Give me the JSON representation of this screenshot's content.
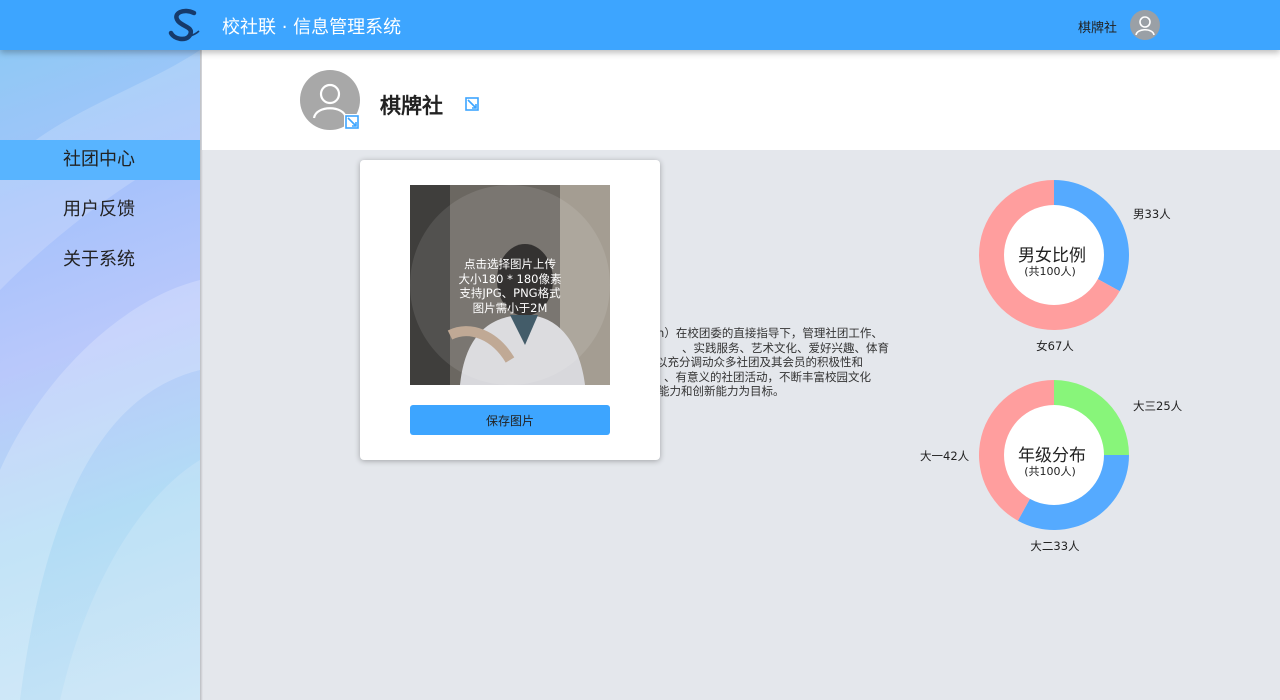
{
  "header": {
    "title": "校社联 · 信息管理系统",
    "username": "棋牌社"
  },
  "sidebar": {
    "items": [
      {
        "label": "社团中心",
        "active": true
      },
      {
        "label": "用户反馈",
        "active": false
      },
      {
        "label": "关于系统",
        "active": false
      }
    ]
  },
  "club": {
    "name": "棋牌社"
  },
  "description": {
    "lines": [
      "on）在校团委的直接指导下，管理社团工作、",
      "、实践服务、艺术文化、爱好兴趣、体育",
      "以充分调动众多社团及其会员的积极性和",
      "、有意义的社团活动，不断丰富校园文化",
      "能力和创新能力为目标。"
    ]
  },
  "upload": {
    "hint_lines": [
      "点击选择图片上传",
      "大小180 * 180像素",
      "支持JPG、PNG格式",
      "图片需小于2M"
    ],
    "save_label": "保存图片"
  },
  "chart_data": [
    {
      "type": "pie",
      "title": "男女比例",
      "subtitle": "(共100人)",
      "slices": [
        {
          "label": "男33人",
          "value": 33,
          "color": "#55aaff"
        },
        {
          "label": "女67人",
          "value": 67,
          "color": "#ff9e9e"
        }
      ]
    },
    {
      "type": "pie",
      "title": "年级分布",
      "subtitle": "(共100人)",
      "slices": [
        {
          "label": "大三25人",
          "value": 25,
          "color": "#88f57a"
        },
        {
          "label": "大二33人",
          "value": 33,
          "color": "#55aaff"
        },
        {
          "label": "大一42人",
          "value": 42,
          "color": "#ff9e9e"
        }
      ]
    }
  ]
}
